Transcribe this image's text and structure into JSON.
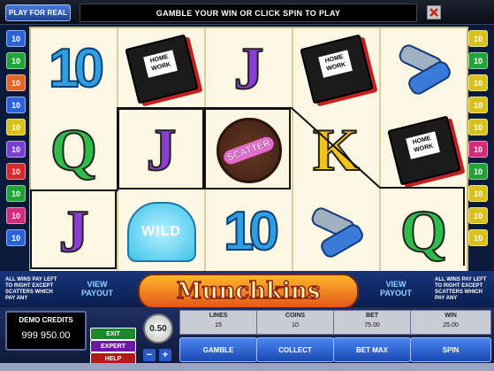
{
  "topbar": {
    "play_for_real": "PLAY FOR REAL",
    "message": "GAMBLE YOUR WIN OR CLICK SPIN TO PLAY"
  },
  "paylines": {
    "numbers": [
      "10",
      "10",
      "10",
      "10",
      "10",
      "10",
      "10",
      "10",
      "10",
      "10"
    ],
    "colors": [
      "#2b63d6",
      "#22a33a",
      "#e0672a",
      "#2b63d6",
      "#d8c21a",
      "#7a3fd1",
      "#d42a2a",
      "#22a33a",
      "#d42a7a",
      "#2b63d6"
    ]
  },
  "reels": [
    [
      "10",
      "Q",
      "J"
    ],
    [
      "book",
      "J",
      "wild"
    ],
    [
      "J",
      "scatter",
      "10"
    ],
    [
      "book",
      "K",
      "keys"
    ],
    [
      "keys",
      "book",
      "Q"
    ]
  ],
  "symbols": {
    "book_label": "HOME WORK",
    "scatter_label": "SCATTER",
    "wild_label": "WILD"
  },
  "info_left": "ALL WINS PAY LEFT TO RIGHT EXCEPT SCATTERS WHICH PAY ANY",
  "info_right": "ALL WINS PAY LEFT TO RIGHT EXCEPT SCATTERS WHICH PAY ANY",
  "view_payout": "VIEW PAYOUT",
  "logo": "Munchkins",
  "credits": {
    "label": "DEMO CREDITS",
    "value": "999 950.00"
  },
  "side_buttons": {
    "exit": "EXIT",
    "expert": "EXPERT",
    "help": "HELP"
  },
  "coin_value": "0.50",
  "stats": {
    "lines_label": "LINES",
    "lines_value": "15",
    "coins_label": "COINS",
    "coins_value": "10",
    "bet_label": "BET",
    "bet_value": "75.00",
    "win_label": "WIN",
    "win_value": "25.00"
  },
  "actions": {
    "gamble": "GAMBLE",
    "collect": "COLLECT",
    "bet_max": "BET MAX",
    "spin": "SPIN"
  },
  "controls": {
    "minus": "−",
    "plus": "+"
  }
}
